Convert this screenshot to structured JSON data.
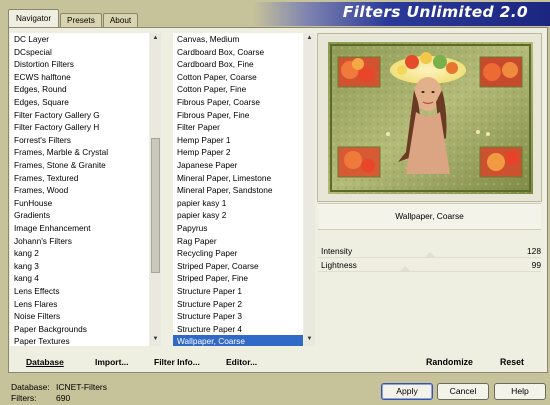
{
  "tabs": [
    "Navigator",
    "Presets",
    "About"
  ],
  "banner": {
    "title": "Filters Unlimited 2.0"
  },
  "categories": [
    "DC Layer",
    "DCspecial",
    "Distortion Filters",
    "ECWS halftone",
    "Edges, Round",
    "Edges, Square",
    "Filter Factory Gallery G",
    "Filter Factory Gallery H",
    "Forrest's Filters",
    "Frames, Marble & Crystal",
    "Frames, Stone & Granite",
    "Frames, Textured",
    "Frames, Wood",
    "FunHouse",
    "Gradients",
    "Image Enhancement",
    "Johann's Filters",
    "kang 2",
    "kang 3",
    "kang 4",
    "Lens Effects",
    "Lens Flares",
    "Noise Filters",
    "Paper Backgrounds",
    "Paper Textures"
  ],
  "filters": [
    "Canvas, Medium",
    "Cardboard Box, Coarse",
    "Cardboard Box, Fine",
    "Cotton Paper, Coarse",
    "Cotton Paper, Fine",
    "Fibrous Paper, Coarse",
    "Fibrous Paper, Fine",
    "Filter Paper",
    "Hemp Paper 1",
    "Hemp Paper 2",
    "Japanese Paper",
    "Mineral Paper, Limestone",
    "Mineral Paper, Sandstone",
    "papier kasy 1",
    "papier kasy 2",
    "Papyrus",
    "Rag Paper",
    "Recycling Paper",
    "Striped Paper, Coarse",
    "Striped Paper, Fine",
    "Structure Paper 1",
    "Structure Paper 2",
    "Structure Paper 3",
    "Structure Paper 4",
    "Wallpaper, Coarse"
  ],
  "selected_category": "Paper Textures",
  "selected_filter": "Wallpaper, Coarse",
  "toolbar": {
    "database": "Database",
    "import": "Import...",
    "filter_info": "Filter Info...",
    "editor": "Editor...",
    "randomize": "Randomize",
    "reset": "Reset"
  },
  "preview": {
    "filter_name": "Wallpaper, Coarse"
  },
  "params": [
    {
      "name": "Intensity",
      "value": "128",
      "level": 0.5
    },
    {
      "name": "Lightness",
      "value": "99",
      "level": 0.39
    }
  ],
  "footer": {
    "database_label": "Database:",
    "database_value": "ICNET-Filters",
    "filters_label": "Filters:",
    "filters_value": "690"
  },
  "buttons": {
    "apply": "Apply",
    "cancel": "Cancel",
    "help": "Help"
  },
  "colors": {
    "accent": "#3169c6",
    "banner": "#1b2680",
    "panel": "#efefe1",
    "frame": "#c6c299"
  }
}
